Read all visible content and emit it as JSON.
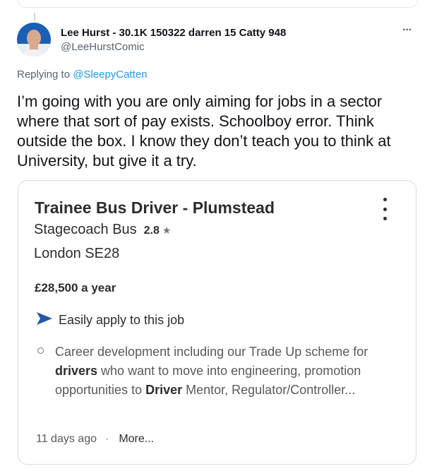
{
  "tweet": {
    "display_name": "Lee Hurst - 30.1K 150322 darren 15 Catty 948",
    "handle": "@LeeHurstComic",
    "more_icon": "more-horizontal-icon",
    "reply_prefix": "Replying to",
    "reply_to": "@SleepyCatten",
    "text": "I’m going with you are only aiming for jobs in a sector where that sort of pay exists. Schoolboy error. Think outside the box. I know they don’t teach you to think at University, but give it a try."
  },
  "job": {
    "title": "Trainee Bus Driver - Plumstead",
    "company": "Stagecoach Bus",
    "rating": "2.8",
    "star": "★",
    "location": "London SE28",
    "salary": "£28,500 a year",
    "apply_label": "Easily apply to this job",
    "apply_color": "#2557a7",
    "snippet": [
      {
        "t": "Career development including our Trade Up scheme for ",
        "b": false
      },
      {
        "t": "drivers",
        "b": true
      },
      {
        "t": " who want to move into engineering, promotion opportunities to ",
        "b": false
      },
      {
        "t": "Driver",
        "b": true
      },
      {
        "t": " Mentor, Regulator/Controller...",
        "b": false
      }
    ],
    "posted": "11 days ago",
    "separator": "·",
    "more_label": "More..."
  }
}
